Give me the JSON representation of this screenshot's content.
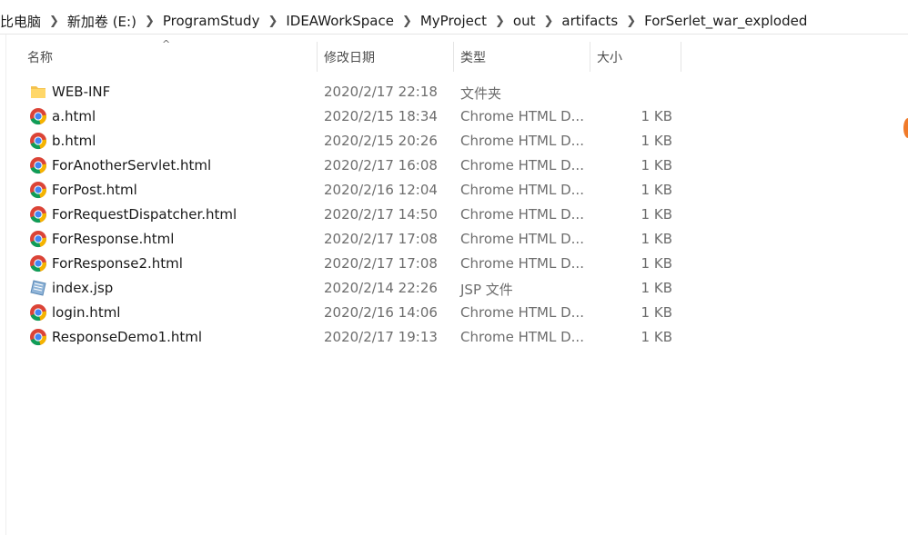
{
  "breadcrumb": [
    "比电脑",
    "新加卷 (E:)",
    "ProgramStudy",
    "IDEAWorkSpace",
    "MyProject",
    "out",
    "artifacts",
    "ForSerlet_war_exploded"
  ],
  "columns": {
    "name": "名称",
    "date": "修改日期",
    "type": "类型",
    "size": "大小"
  },
  "sort_indicator": "^",
  "files": [
    {
      "icon": "folder-icon",
      "name": "WEB-INF",
      "date": "2020/2/17 22:18",
      "type": "文件夹",
      "size": ""
    },
    {
      "icon": "chrome-icon",
      "name": "a.html",
      "date": "2020/2/15 18:34",
      "type": "Chrome HTML D...",
      "size": "1 KB"
    },
    {
      "icon": "chrome-icon",
      "name": "b.html",
      "date": "2020/2/15 20:26",
      "type": "Chrome HTML D...",
      "size": "1 KB"
    },
    {
      "icon": "chrome-icon",
      "name": "ForAnotherServlet.html",
      "date": "2020/2/17 16:08",
      "type": "Chrome HTML D...",
      "size": "1 KB"
    },
    {
      "icon": "chrome-icon",
      "name": "ForPost.html",
      "date": "2020/2/16 12:04",
      "type": "Chrome HTML D...",
      "size": "1 KB"
    },
    {
      "icon": "chrome-icon",
      "name": "ForRequestDispatcher.html",
      "date": "2020/2/17 14:50",
      "type": "Chrome HTML D...",
      "size": "1 KB"
    },
    {
      "icon": "chrome-icon",
      "name": "ForResponse.html",
      "date": "2020/2/17 17:08",
      "type": "Chrome HTML D...",
      "size": "1 KB"
    },
    {
      "icon": "chrome-icon",
      "name": "ForResponse2.html",
      "date": "2020/2/17 17:08",
      "type": "Chrome HTML D...",
      "size": "1 KB"
    },
    {
      "icon": "jsp-file-icon",
      "name": "index.jsp",
      "date": "2020/2/14 22:26",
      "type": "JSP 文件",
      "size": "1 KB"
    },
    {
      "icon": "chrome-icon",
      "name": "login.html",
      "date": "2020/2/16 14:06",
      "type": "Chrome HTML D...",
      "size": "1 KB"
    },
    {
      "icon": "chrome-icon",
      "name": "ResponseDemo1.html",
      "date": "2020/2/17 19:13",
      "type": "Chrome HTML D...",
      "size": "1 KB"
    }
  ],
  "colors": {
    "folder": "#f4c24d",
    "chrome_red": "#db4437",
    "chrome_green": "#0f9d58",
    "chrome_yellow": "#f4b400",
    "chrome_blue": "#4285f4",
    "accent_orange": "#f07a2a"
  }
}
